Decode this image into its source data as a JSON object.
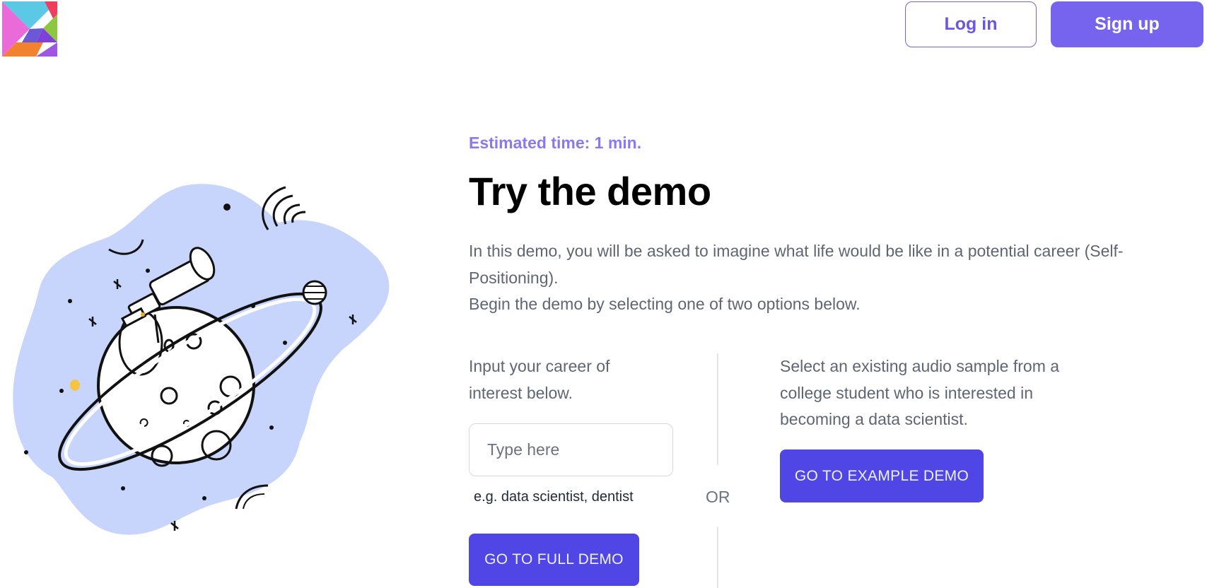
{
  "header": {
    "logo_icon": "tangram-logo-icon",
    "login_label": "Log in",
    "signup_label": "Sign up"
  },
  "colors": {
    "brand_purple": "#7664ef",
    "primary_button": "#4f46e5",
    "accent_text": "#8b79f0",
    "illustration_blob": "#c7d4fc"
  },
  "main": {
    "estimated_time": "Estimated time: 1 min.",
    "title": "Try the demo",
    "description_line1": "In this demo, you will be asked to imagine what life would be like in a potential career (Self-Positioning).",
    "description_line2": "Begin the demo by selecting one of two options below.",
    "left_option": {
      "prompt": "Input your career of interest below.",
      "input_placeholder": "Type here",
      "input_value": "",
      "hint": "e.g. data scientist, dentist",
      "button_label": "GO TO FULL DEMO"
    },
    "or_label": "OR",
    "right_option": {
      "prompt": "Select an existing audio sample from a college student who is interested in becoming a data scientist.",
      "button_label": "GO TO EXAMPLE DEMO"
    },
    "illustration_icon": "astronaut-planet-telescope-illustration"
  }
}
